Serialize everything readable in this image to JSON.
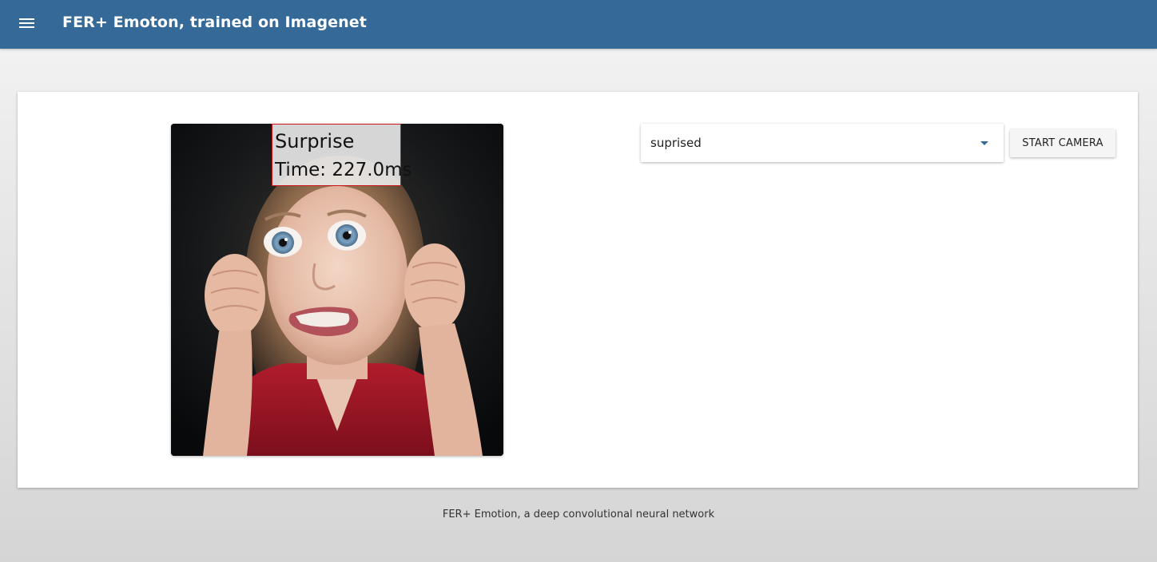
{
  "header": {
    "menu_icon": "hamburger-menu-icon",
    "title": "FER+ Emoton, trained on Imagenet",
    "background_color": "#356a98"
  },
  "main": {
    "image": {
      "prediction_label": "Surprise",
      "prediction_time": "Time: 227.0ms",
      "box_color": "#d0181c"
    },
    "example_select": {
      "selected_value": "suprised"
    },
    "start_camera_button": {
      "label": "START CAMERA"
    }
  },
  "footer": {
    "text": "FER+ Emotion, a deep convolutional neural network"
  }
}
